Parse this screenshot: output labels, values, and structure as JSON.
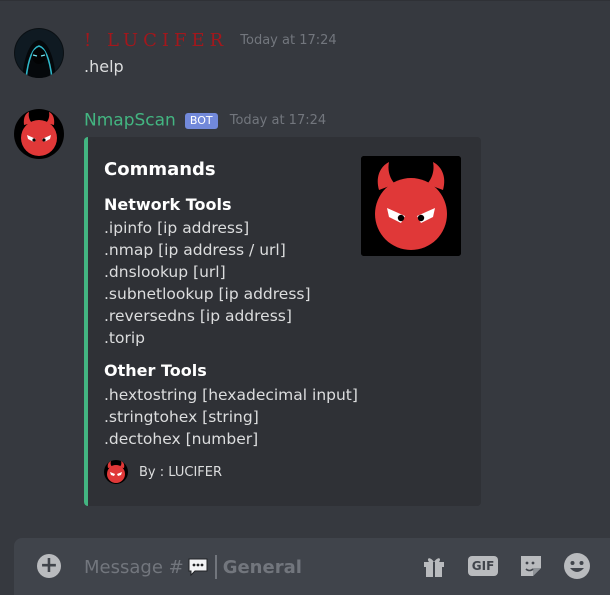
{
  "messages": [
    {
      "username": "! LUCIFER",
      "timestamp": "Today at 17:24",
      "text": ".help"
    },
    {
      "username": "NmapScan",
      "bot_tag": "BOT",
      "timestamp": "Today at 17:24",
      "embed": {
        "title": "Commands",
        "accent_color": "#43b581",
        "fields": [
          {
            "name": "Network Tools",
            "lines": [
              ".ipinfo [ip address]",
              ".nmap [ip address / url]",
              ".dnslookup [url]",
              ".subnetlookup [ip address]",
              ".reversedns [ip address]",
              ".torip"
            ]
          },
          {
            "name": "Other Tools",
            "lines": [
              ".hextostring [hexadecimal input]",
              ".stringtohex [string]",
              ".dectohex [number]"
            ]
          }
        ],
        "footer": "By : LUCIFER"
      }
    }
  ],
  "input": {
    "placeholder": "Message #",
    "channel": "General",
    "icons": [
      "add-icon",
      "chat-bubble-icon",
      "gift-icon",
      "gif-icon",
      "sticker-icon",
      "emoji-icon"
    ]
  },
  "colors": {
    "background": "#36393f",
    "embed_bg": "#2f3136",
    "input_bg": "#40444b",
    "lucifer_name": "#a3171c",
    "bot_name": "#43b581",
    "bot_tag": "#7289da",
    "timestamp": "#72767d"
  }
}
